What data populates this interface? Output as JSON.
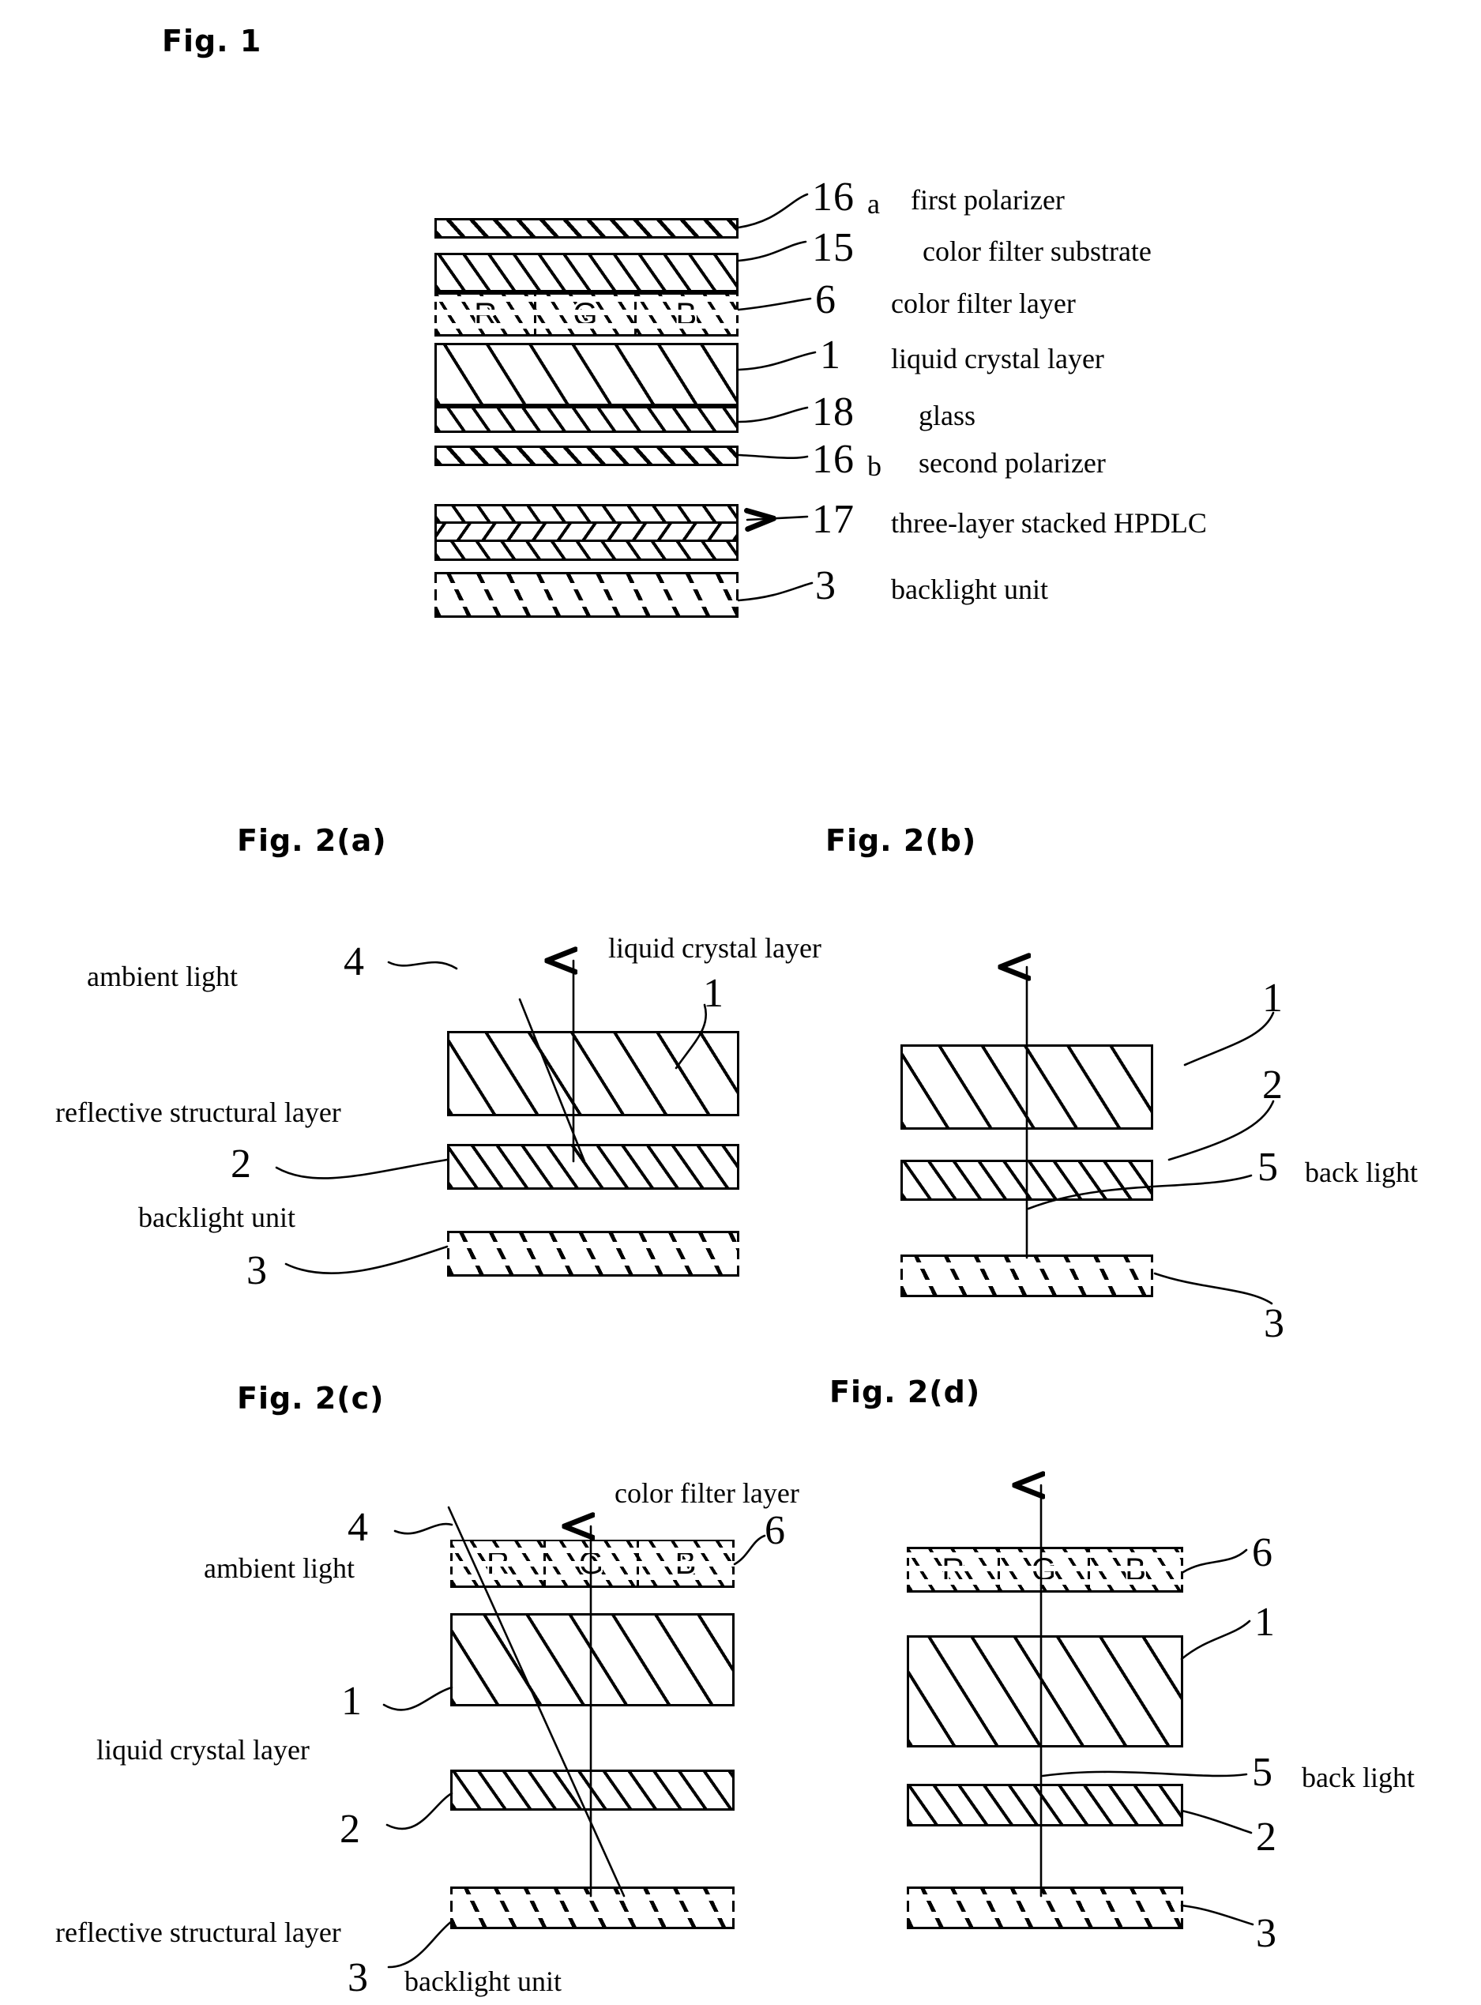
{
  "figures": {
    "fig1": {
      "title": "Fig. 1",
      "layers": [
        {
          "ref": "16",
          "sub": "a",
          "name": "first polarizer"
        },
        {
          "ref": "15",
          "sub": "",
          "name": "color filter substrate"
        },
        {
          "ref": "6",
          "sub": "",
          "name": "color filter layer"
        },
        {
          "ref": "1",
          "sub": "",
          "name": "liquid crystal layer"
        },
        {
          "ref": "18",
          "sub": "",
          "name": "glass"
        },
        {
          "ref": "16",
          "sub": "b",
          "name": "second polarizer"
        },
        {
          "ref": "17",
          "sub": "",
          "name": "three-layer stacked HPDLC"
        },
        {
          "ref": "3",
          "sub": "",
          "name": "backlight unit"
        }
      ],
      "color_filter_cells": [
        "R",
        "G",
        "B"
      ]
    },
    "fig2a": {
      "title": "Fig. 2(a)",
      "labels": {
        "ambient_light": "ambient light",
        "liquid_crystal_layer": "liquid crystal layer",
        "reflective_structural_layer": "reflective structural layer",
        "backlight_unit": "backlight unit"
      },
      "refs": {
        "ambient": "4",
        "lc": "1",
        "reflective": "2",
        "backlight": "3"
      }
    },
    "fig2b": {
      "title": "Fig. 2(b)",
      "labels": {
        "back_light": "back light"
      },
      "refs": {
        "lc": "1",
        "reflective": "2",
        "backlight": "3",
        "back_light": "5"
      }
    },
    "fig2c": {
      "title": "Fig. 2(c)",
      "labels": {
        "ambient_light": "ambient light",
        "color_filter_layer": "color filter layer",
        "liquid_crystal_layer": "liquid crystal layer",
        "reflective_structural_layer": "reflective structural layer",
        "backlight_unit": "backlight unit"
      },
      "refs": {
        "ambient": "4",
        "cf": "6",
        "lc": "1",
        "reflective": "2",
        "backlight": "3"
      },
      "color_filter_cells": [
        "R",
        "G",
        "B"
      ]
    },
    "fig2d": {
      "title": "Fig. 2(d)",
      "labels": {
        "back_light": "back light"
      },
      "refs": {
        "cf": "6",
        "lc": "1",
        "back_light": "5",
        "reflective": "2",
        "backlight": "3"
      },
      "color_filter_cells": [
        "R",
        "G",
        "B"
      ]
    }
  },
  "colors": {
    "ink": "#000000",
    "paper": "#ffffff"
  }
}
